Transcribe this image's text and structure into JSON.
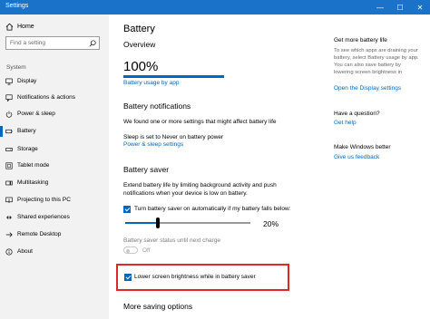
{
  "window": {
    "title": "Settings",
    "controls": {
      "minimize": "—",
      "maximize": "☐",
      "close": "✕"
    }
  },
  "sidebar": {
    "home": "Home",
    "search_placeholder": "Find a setting",
    "group": "System",
    "items": [
      {
        "label": "Display",
        "icon": "monitor-icon"
      },
      {
        "label": "Notifications & actions",
        "icon": "notification-icon"
      },
      {
        "label": "Power & sleep",
        "icon": "power-icon"
      },
      {
        "label": "Battery",
        "icon": "battery-icon",
        "active": true
      },
      {
        "label": "Storage",
        "icon": "storage-icon"
      },
      {
        "label": "Tablet mode",
        "icon": "tablet-icon"
      },
      {
        "label": "Multitasking",
        "icon": "multitasking-icon"
      },
      {
        "label": "Projecting to this PC",
        "icon": "projecting-icon"
      },
      {
        "label": "Shared experiences",
        "icon": "shared-icon"
      },
      {
        "label": "Remote Desktop",
        "icon": "remote-icon"
      },
      {
        "label": "About",
        "icon": "info-icon"
      }
    ]
  },
  "main": {
    "title": "Battery",
    "overview": {
      "heading": "Overview",
      "percent": "100%",
      "percent_value": 1.0,
      "usage_link": "Battery usage by app"
    },
    "notifications": {
      "heading": "Battery notifications",
      "text": "We found one or more settings that might affect battery life",
      "sleep_text": "Sleep is set to Never on battery power",
      "link": "Power & sleep settings"
    },
    "saver": {
      "heading": "Battery saver",
      "desc_line1": "Extend battery life by limiting background activity and push",
      "desc_line2": "notifications when your device is low on battery.",
      "auto_label": "Turn battery saver on automatically if my battery falls below:",
      "slider_value": "20%",
      "status_label": "Battery saver status until next charge",
      "toggle_label": "Off",
      "brightness_label": "Lower screen brightness while in battery saver"
    },
    "more": {
      "heading": "More saving options"
    }
  },
  "right": {
    "more_life_heading": "Get more battery life",
    "more_life_text": [
      "To see which apps are draining your",
      "battery, select Battery usage by app.",
      "You can also save battery by",
      "lowering screen brightness in"
    ],
    "display_link": "Open the Display settings",
    "question_heading": "Have a question?",
    "help_link": "Get help",
    "better_heading": "Make Windows better",
    "feedback_link": "Give us feedback"
  },
  "colors": {
    "accent": "#0067c0",
    "titlebar": "#1a73c8",
    "sidebar_bg": "#f2f2f2",
    "highlight_box": "#e0262b"
  }
}
